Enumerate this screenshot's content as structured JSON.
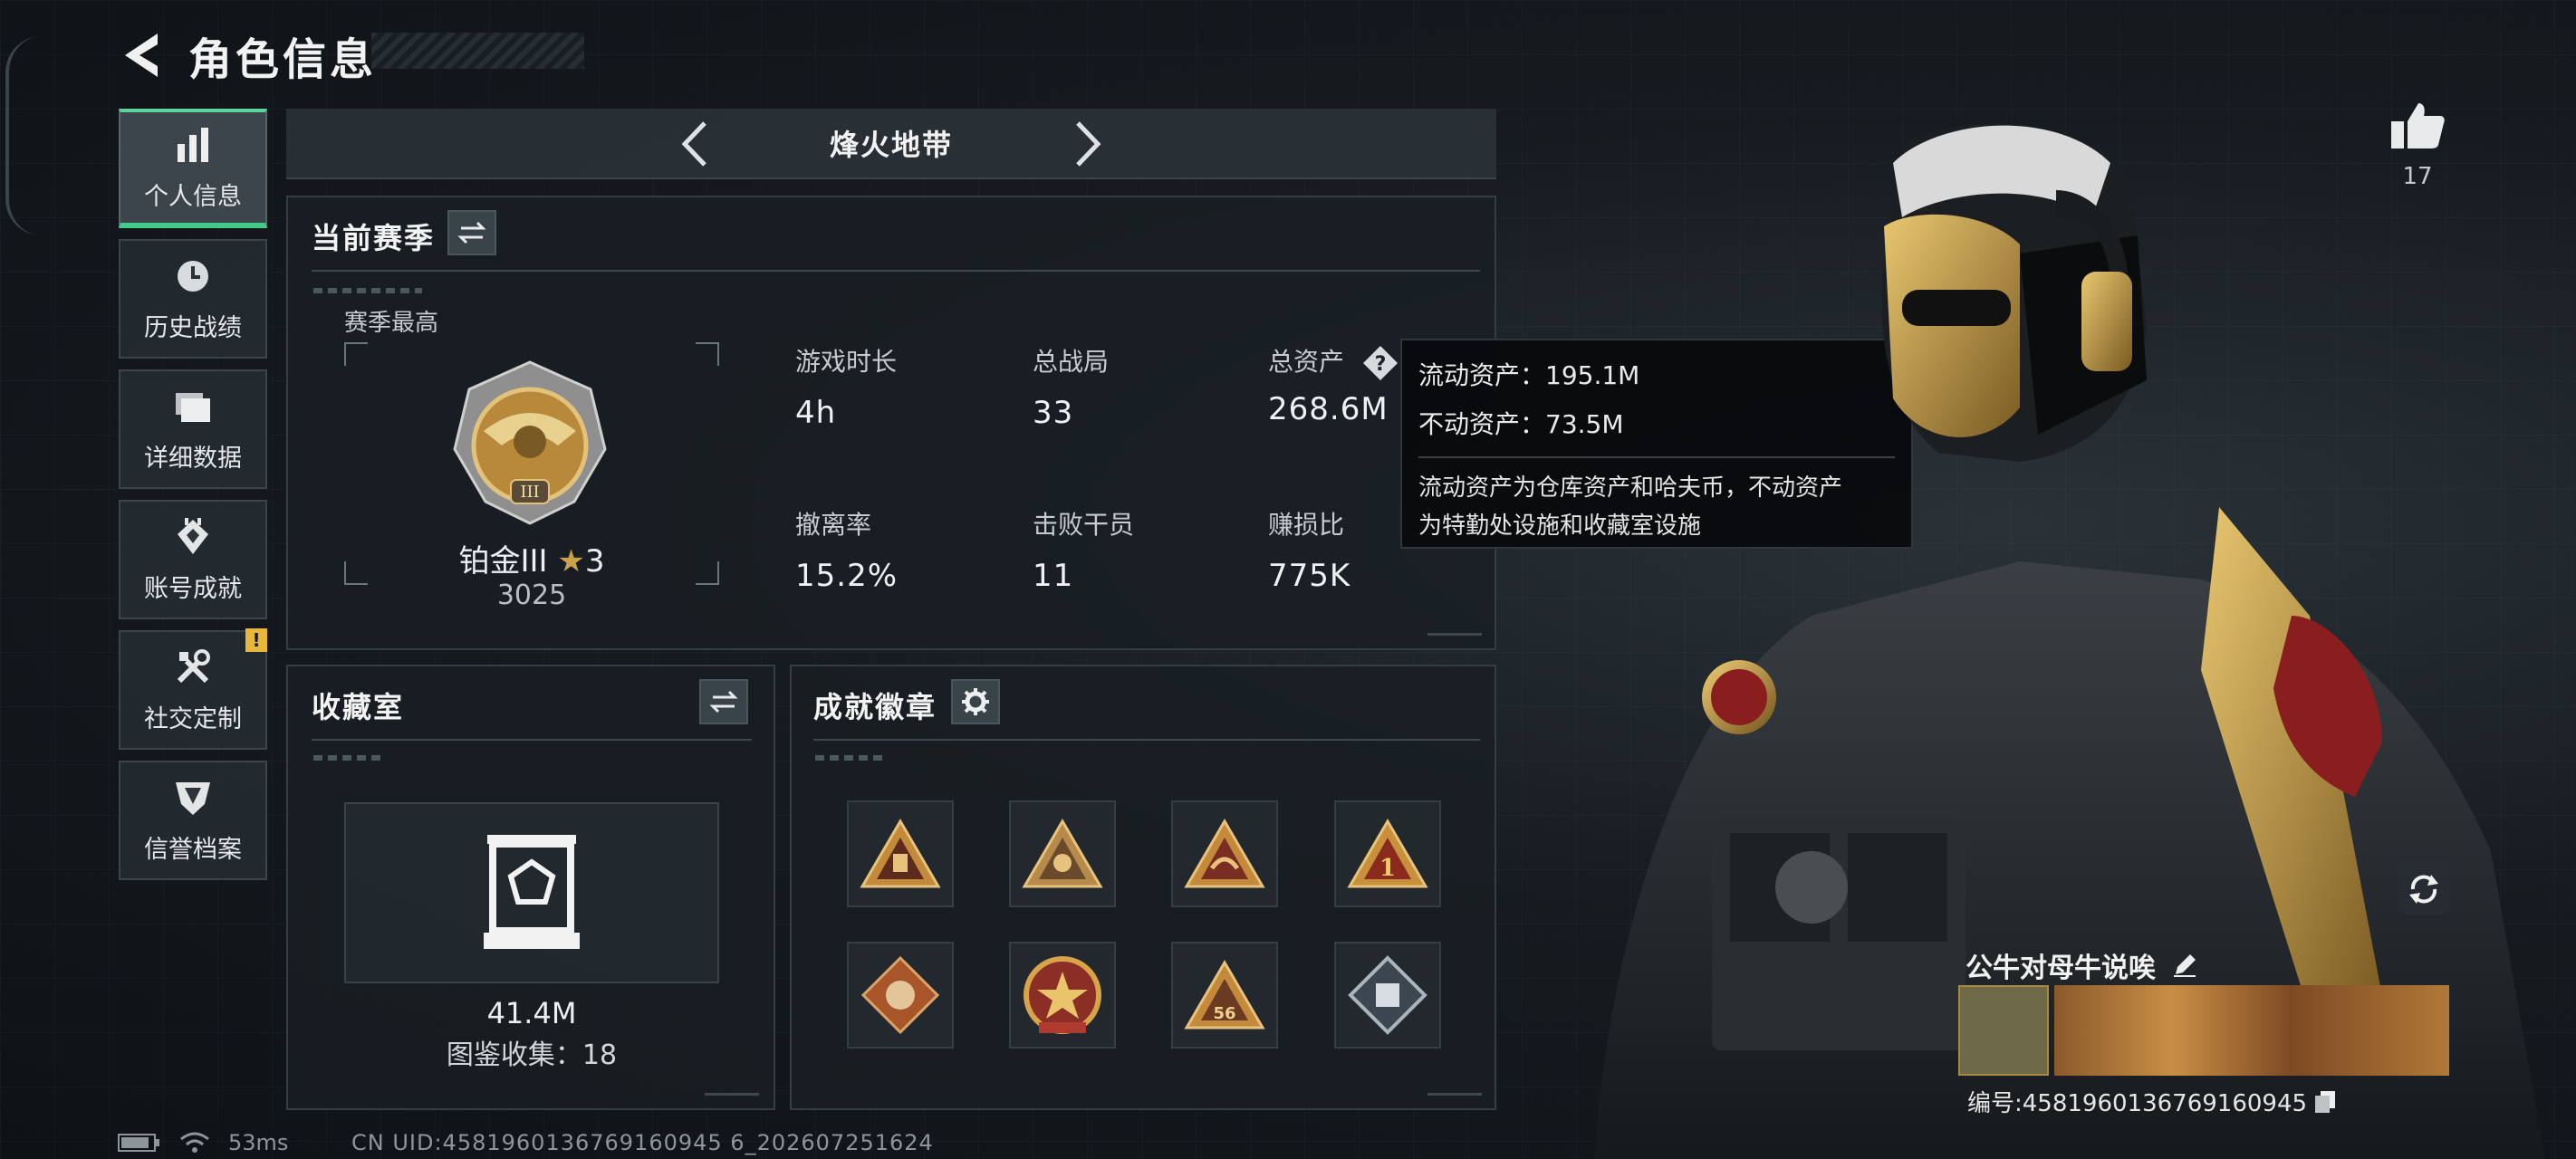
{
  "header": {
    "title": "角色信息"
  },
  "nav": {
    "items": [
      {
        "label": "个人信息",
        "icon": "bar-chart-icon",
        "active": true
      },
      {
        "label": "历史战绩",
        "icon": "clock-history-icon"
      },
      {
        "label": "详细数据",
        "icon": "folder-icon"
      },
      {
        "label": "账号成就",
        "icon": "achievement-icon"
      },
      {
        "label": "社交定制",
        "icon": "tools-icon",
        "badge": "!"
      },
      {
        "label": "信誉档案",
        "icon": "shield-icon"
      }
    ]
  },
  "mode": {
    "title": "烽火地带"
  },
  "season": {
    "title": "当前赛季",
    "best_label": "赛季最高",
    "rank_name": "铂金III",
    "rank_stars": "3",
    "rank_score": "3025",
    "stats": [
      {
        "label": "游戏时长",
        "value": "4h"
      },
      {
        "label": "总战局",
        "value": "33"
      },
      {
        "label": "总资产",
        "value": "268.6M"
      },
      {
        "label": "撤离率",
        "value": "15.2%"
      },
      {
        "label": "击败干员",
        "value": "11"
      },
      {
        "label": "赚损比",
        "value": "775K"
      }
    ]
  },
  "tooltip": {
    "liquid": "流动资产：195.1M",
    "fixed": "不动资产：73.5M",
    "note_line1": "流动资产为仓库资产和哈夫币，不动资产",
    "note_line2": "为特勤处设施和收藏室设施"
  },
  "collection": {
    "title": "收藏室",
    "value": "41.4M",
    "count": "图鉴收集：18"
  },
  "achievements": {
    "title": "成就徽章"
  },
  "like": {
    "count": "17"
  },
  "player": {
    "name": "公牛对母牛说唉",
    "id": "编号:4581960136769160945"
  },
  "status": {
    "ping": "53ms",
    "uid": "CN UID:4581960136769160945 6_202607251624"
  },
  "colors": {
    "accent": "#43c98a",
    "gold": "#c9a24a",
    "warning": "#e9b73c"
  }
}
